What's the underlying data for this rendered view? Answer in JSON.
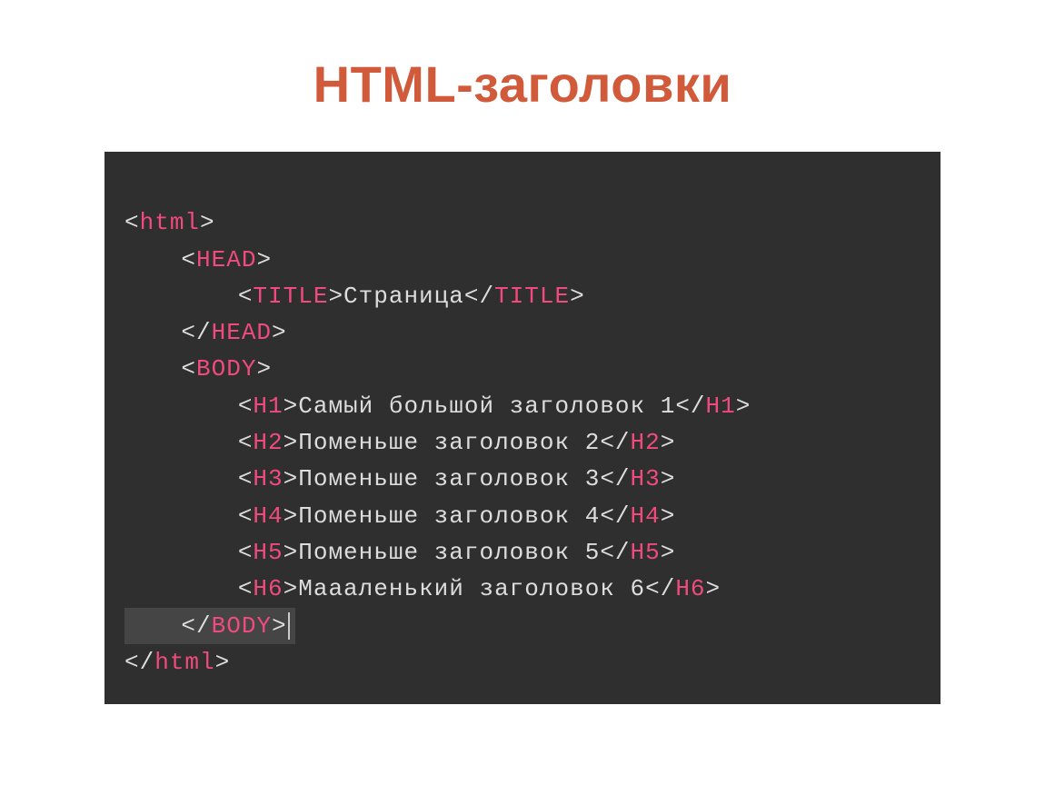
{
  "slide_title": "HTML-заголовки",
  "code": {
    "tags": {
      "html": "html",
      "head": "HEAD",
      "title": "TITLE",
      "body": "BODY",
      "h1": "H1",
      "h2": "H2",
      "h3": "H3",
      "h4": "H4",
      "h5": "H5",
      "h6": "H6"
    },
    "text": {
      "title_text": "Страница",
      "h1_text": "Самый большой заголовок 1",
      "h2_text": "Поменьше заголовок 2",
      "h3_text": "Поменьше заголовок 3",
      "h4_text": "Поменьше заголовок 4",
      "h5_text": "Поменьше заголовок 5",
      "h6_text": "Маааленький заголовок 6"
    }
  }
}
